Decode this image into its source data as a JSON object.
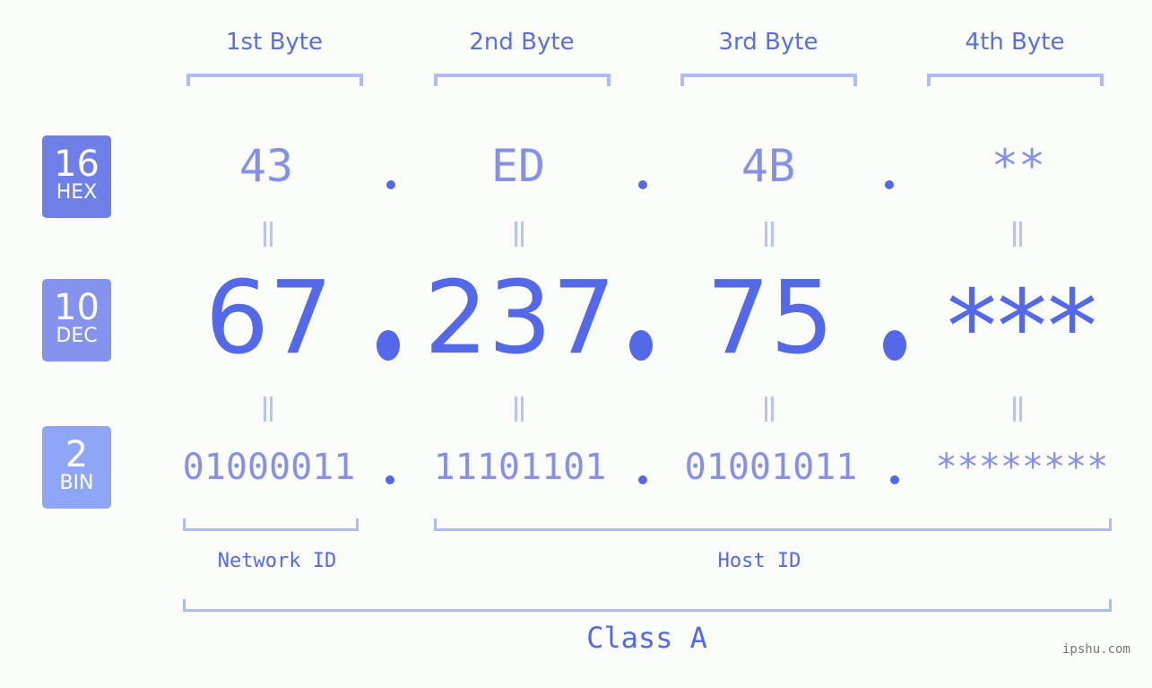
{
  "badges": [
    {
      "num": "16",
      "label": "HEX",
      "color": "#6f7fe8"
    },
    {
      "num": "10",
      "label": "DEC",
      "color": "#8593ee"
    },
    {
      "num": "2",
      "label": "BIN",
      "color": "#8fa6f6"
    }
  ],
  "byte_labels": [
    "1st Byte",
    "2nd Byte",
    "3rd Byte",
    "4th Byte"
  ],
  "hex": [
    "43",
    "ED",
    "4B",
    "**"
  ],
  "dec": [
    "67",
    "237",
    "75",
    "***"
  ],
  "bin": [
    "01000011",
    "11101101",
    "01001011",
    "********"
  ],
  "network_id_label": "Network ID",
  "host_id_label": "Host ID",
  "class_label": "Class A",
  "watermark": "ipshu.com",
  "colors": {
    "accent": "#5468ea",
    "light": "#8690ea",
    "bracket": "#b0baf5"
  }
}
